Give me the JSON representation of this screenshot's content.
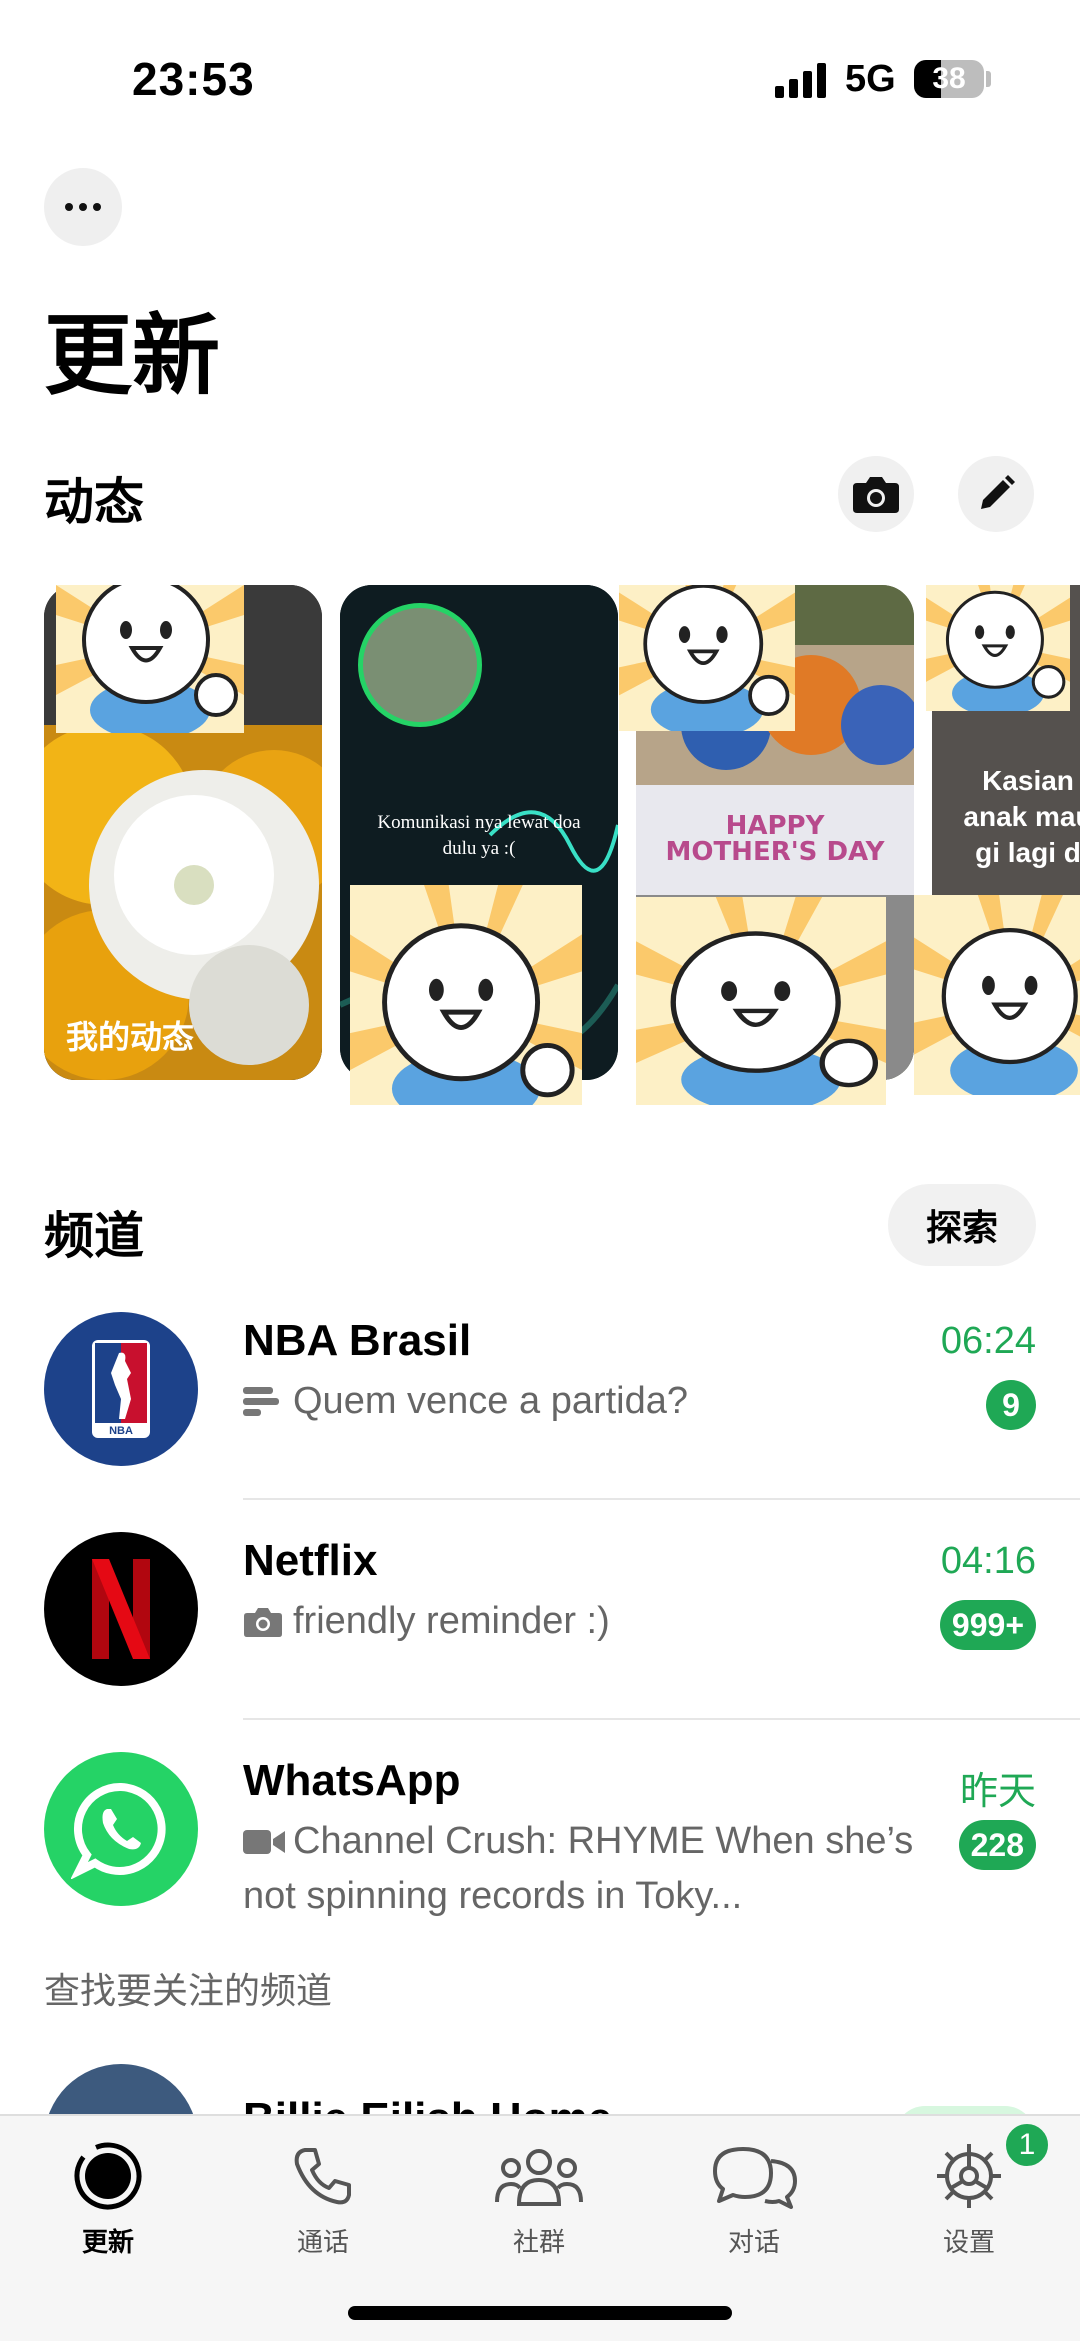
{
  "status_bar": {
    "time": "23:53",
    "network": "5G",
    "battery": "38"
  },
  "header": {
    "title": "更新",
    "more_icon": "ellipsis-icon"
  },
  "status_section": {
    "title": "动态",
    "camera_icon": "camera-icon",
    "edit_icon": "pencil-icon",
    "cards": [
      {
        "label": "我的动态"
      },
      {
        "text": "Komunikasi nya lewat doa dulu ya :("
      },
      {
        "text": "HAPPY MOTHER'S DAY"
      },
      {
        "text": "Kasian anak mau gi lagi d"
      }
    ]
  },
  "channels_section": {
    "title": "频道",
    "explore_label": "探索",
    "channels": [
      {
        "name": "NBA Brasil",
        "icon": "poll-icon",
        "message": "Quem vence a partida?",
        "time": "06:24",
        "unread": "9"
      },
      {
        "name": "Netflix",
        "icon": "camera-icon",
        "message": "friendly reminder :)",
        "time": "04:16",
        "unread": "999+"
      },
      {
        "name": "WhatsApp",
        "icon": "video-icon",
        "message": "Channel Crush: RHYME When she’s not spinning records in Toky...",
        "time": "昨天",
        "unread": "228"
      }
    ],
    "find_label": "查找要关注的频道",
    "suggested": {
      "name": "Billie Eilish Home"
    }
  },
  "tab_bar": {
    "tabs": [
      {
        "label": "更新",
        "icon": "updates-icon",
        "active": true
      },
      {
        "label": "通话",
        "icon": "phone-icon"
      },
      {
        "label": "社群",
        "icon": "communities-icon"
      },
      {
        "label": "对话",
        "icon": "chats-icon"
      },
      {
        "label": "设置",
        "icon": "settings-icon"
      }
    ],
    "settings_badge": "1"
  },
  "colors": {
    "accent": "#1fa855",
    "status_ring": "#25d366",
    "nba_blue": "#1d428a",
    "netflix_red": "#e50914",
    "whatsapp_green": "#25d366"
  }
}
